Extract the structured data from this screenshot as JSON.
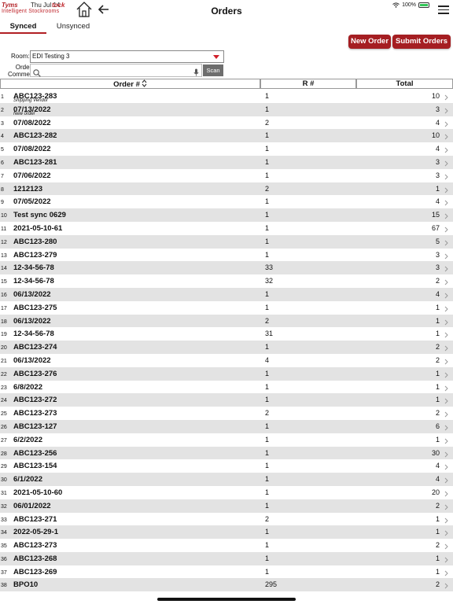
{
  "header": {
    "logo_brand": "Tyms",
    "logo_tm": "tock",
    "logo_time": "Thu Jul 14",
    "logo_tagline": "Intelligent Stockrooms",
    "title": "Orders",
    "battery": "100%"
  },
  "tabs": [
    {
      "label": "Synced",
      "active": true
    },
    {
      "label": "Unsynced",
      "active": false
    }
  ],
  "buttons": {
    "new_order": "New Order",
    "submit_orders": "Submit Orders",
    "scan": "Scan"
  },
  "filters": {
    "room_label": "Room:",
    "room_value": "EDI Testing 3",
    "order_label": "Order#/",
    "comment_label": "Comment:",
    "search_value": ""
  },
  "table": {
    "columns": [
      "Order #",
      "R #",
      "Total"
    ],
    "rows": [
      {
        "n": "1",
        "order": "ABC123-283",
        "sub": "Shipping Vendor",
        "r": "1",
        "total": "10"
      },
      {
        "n": "2",
        "order": "07/13/2022",
        "sub": "New order",
        "r": "1",
        "total": "3"
      },
      {
        "n": "3",
        "order": "07/08/2022",
        "sub": "",
        "r": "2",
        "total": "4"
      },
      {
        "n": "4",
        "order": "ABC123-282",
        "sub": "",
        "r": "1",
        "total": "10"
      },
      {
        "n": "5",
        "order": "07/08/2022",
        "sub": "",
        "r": "1",
        "total": "4"
      },
      {
        "n": "6",
        "order": "ABC123-281",
        "sub": "",
        "r": "1",
        "total": "3"
      },
      {
        "n": "7",
        "order": "07/06/2022",
        "sub": "",
        "r": "1",
        "total": "3"
      },
      {
        "n": "8",
        "order": "1212123",
        "sub": "",
        "r": "2",
        "total": "1"
      },
      {
        "n": "9",
        "order": "07/05/2022",
        "sub": "",
        "r": "1",
        "total": "4"
      },
      {
        "n": "10",
        "order": "Test sync 0629",
        "sub": "",
        "r": "1",
        "total": "15"
      },
      {
        "n": "11",
        "order": "2021-05-10-61",
        "sub": "",
        "r": "1",
        "total": "67"
      },
      {
        "n": "12",
        "order": "ABC123-280",
        "sub": "",
        "r": "1",
        "total": "5"
      },
      {
        "n": "13",
        "order": "ABC123-279",
        "sub": "",
        "r": "1",
        "total": "3"
      },
      {
        "n": "14",
        "order": "12-34-56-78",
        "sub": "",
        "r": "33",
        "total": "3"
      },
      {
        "n": "15",
        "order": "12-34-56-78",
        "sub": "",
        "r": "32",
        "total": "2"
      },
      {
        "n": "16",
        "order": "06/13/2022",
        "sub": "",
        "r": "1",
        "total": "4"
      },
      {
        "n": "17",
        "order": "ABC123-275",
        "sub": "",
        "r": "1",
        "total": "1"
      },
      {
        "n": "18",
        "order": "06/13/2022",
        "sub": "",
        "r": "2",
        "total": "1"
      },
      {
        "n": "19",
        "order": "12-34-56-78",
        "sub": "",
        "r": "31",
        "total": "1"
      },
      {
        "n": "20",
        "order": "ABC123-274",
        "sub": "",
        "r": "1",
        "total": "2"
      },
      {
        "n": "21",
        "order": "06/13/2022",
        "sub": "",
        "r": "4",
        "total": "2"
      },
      {
        "n": "22",
        "order": "ABC123-276",
        "sub": "",
        "r": "1",
        "total": "1"
      },
      {
        "n": "23",
        "order": "6/8/2022",
        "sub": "",
        "r": "1",
        "total": "1"
      },
      {
        "n": "24",
        "order": "ABC123-272",
        "sub": "",
        "r": "1",
        "total": "1"
      },
      {
        "n": "25",
        "order": "ABC123-273",
        "sub": "",
        "r": "2",
        "total": "2"
      },
      {
        "n": "26",
        "order": "ABC123-127",
        "sub": "",
        "r": "1",
        "total": "6"
      },
      {
        "n": "27",
        "order": "6/2/2022",
        "sub": "",
        "r": "1",
        "total": "1"
      },
      {
        "n": "28",
        "order": "ABC123-256",
        "sub": "",
        "r": "1",
        "total": "30"
      },
      {
        "n": "29",
        "order": "ABC123-154",
        "sub": "",
        "r": "1",
        "total": "4"
      },
      {
        "n": "30",
        "order": "6/1/2022",
        "sub": "",
        "r": "1",
        "total": "4"
      },
      {
        "n": "31",
        "order": "2021-05-10-60",
        "sub": "",
        "r": "1",
        "total": "20"
      },
      {
        "n": "32",
        "order": "06/01/2022",
        "sub": "",
        "r": "1",
        "total": "2"
      },
      {
        "n": "33",
        "order": "ABC123-271",
        "sub": "",
        "r": "2",
        "total": "1"
      },
      {
        "n": "34",
        "order": "2022-05-29-1",
        "sub": "",
        "r": "1",
        "total": "1"
      },
      {
        "n": "35",
        "order": "ABC123-273",
        "sub": "",
        "r": "1",
        "total": "2"
      },
      {
        "n": "36",
        "order": "ABC123-268",
        "sub": "",
        "r": "1",
        "total": "1"
      },
      {
        "n": "37",
        "order": "ABC123-269",
        "sub": "",
        "r": "1",
        "total": "1"
      },
      {
        "n": "38",
        "order": "BPO10",
        "sub": "",
        "r": "295",
        "total": "2"
      }
    ]
  },
  "colors": {
    "accent": "#a51e22",
    "row_alt": "#e3e3e3",
    "caret": "#d0202a",
    "battery": "#34c759"
  }
}
